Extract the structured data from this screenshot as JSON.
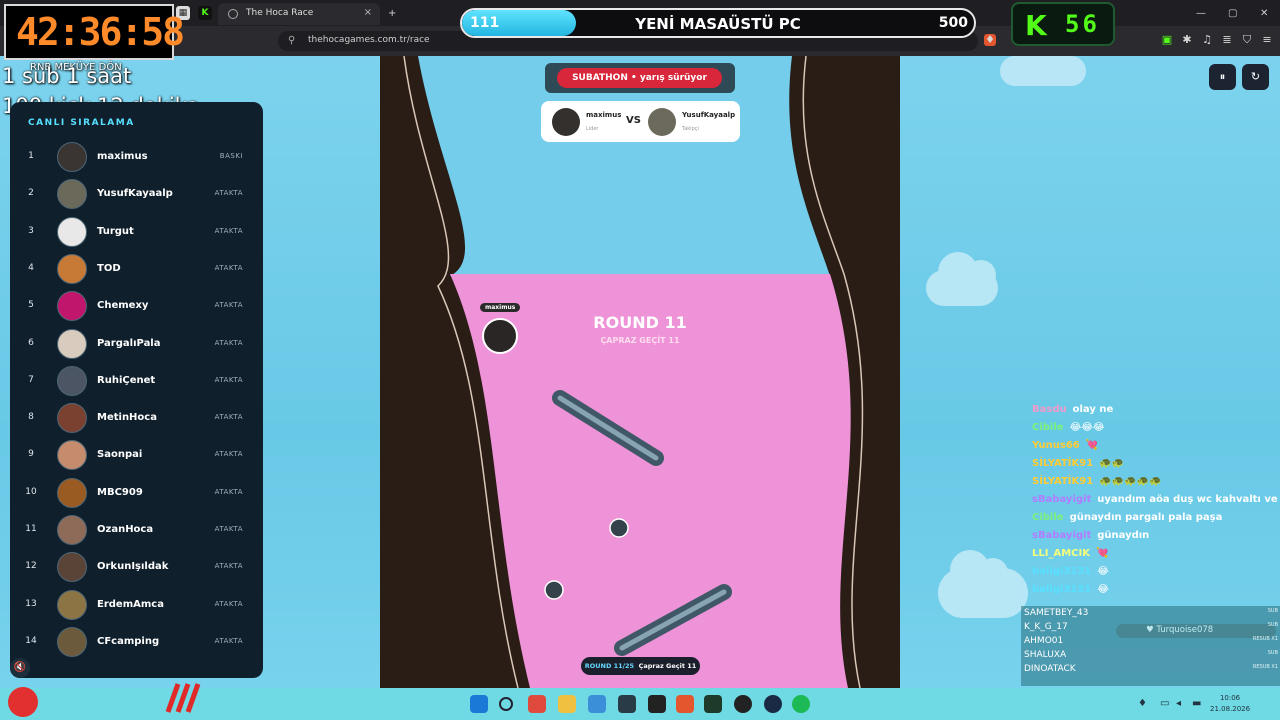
{
  "browser": {
    "tab_title": "The Hoca Race",
    "url": "thehocagames.com.tr/race"
  },
  "timer": "42:36:58",
  "progress": {
    "current": "111",
    "title": "YENİ MASAÜSTÜ PC",
    "max": "500",
    "fraction": 0.222
  },
  "kick_counter": {
    "letter": "K",
    "count": "56"
  },
  "overlay": {
    "line0": "RNB MEKÜYE DÖN",
    "line1": "1 sub 1 saat",
    "line2": "100 kick 12 dakika"
  },
  "leaderboard": {
    "header": "CANLI SIRALAMA",
    "rows": [
      {
        "rank": "1",
        "name": "maximus",
        "status": "BASKI",
        "color": "#3a3533"
      },
      {
        "rank": "2",
        "name": "YusufKayaalp",
        "status": "ATAKTA",
        "color": "#6b6a5a"
      },
      {
        "rank": "3",
        "name": "Turgut",
        "status": "ATAKTA",
        "color": "#e8e8e8"
      },
      {
        "rank": "4",
        "name": "TOD",
        "status": "ATAKTA",
        "color": "#c77a36"
      },
      {
        "rank": "5",
        "name": "Chemexy",
        "status": "ATAKTA",
        "color": "#c0166b"
      },
      {
        "rank": "6",
        "name": "PargalıPala",
        "status": "ATAKTA",
        "color": "#d9cbbd"
      },
      {
        "rank": "7",
        "name": "RuhiÇenet",
        "status": "ATAKTA",
        "color": "#4c5563"
      },
      {
        "rank": "8",
        "name": "MetinHoca",
        "status": "ATAKTA",
        "color": "#7a4030"
      },
      {
        "rank": "9",
        "name": "Saonpai",
        "status": "ATAKTA",
        "color": "#c48c6c"
      },
      {
        "rank": "10",
        "name": "MBC909",
        "status": "ATAKTA",
        "color": "#9a5b22"
      },
      {
        "rank": "11",
        "name": "OzanHoca",
        "status": "ATAKTA",
        "color": "#8e6a58"
      },
      {
        "rank": "12",
        "name": "OrkunIşıldak",
        "status": "ATAKTA",
        "color": "#5a4438"
      },
      {
        "rank": "13",
        "name": "ErdemAmca",
        "status": "ATAKTA",
        "color": "#8c7444"
      },
      {
        "rank": "14",
        "name": "CFcamping",
        "status": "ATAKTA",
        "color": "#6b5a3c"
      }
    ]
  },
  "game": {
    "subathon": "SUBATHON • yarış sürüyor",
    "vs": {
      "left_name": "maximus",
      "left_sub": "Lider",
      "vs": "VS",
      "right_name": "YusufKayaalp",
      "right_sub": "Takipçi"
    },
    "round_title": "ROUND 11",
    "round_subtitle": "ÇAPRAZ GEÇİT 11",
    "player_tag": "maximus",
    "round_pill_label": "ROUND 11/25",
    "round_pill_name": "Çapraz Geçit 11"
  },
  "controls": {
    "pause": "⏸",
    "refresh": "↻"
  },
  "chat": [
    {
      "user": "Basdu",
      "msg": "olay ne",
      "color": "#f39acb"
    },
    {
      "user": "Cibile",
      "msg": "😂😂😂",
      "color": "#7cf07c"
    },
    {
      "user": "Yunus66",
      "msg": "💘",
      "color": "#ffcc33"
    },
    {
      "user": "SİLYATİK91",
      "msg": "🐢🐢",
      "color": "#ffcc33"
    },
    {
      "user": "SİLYATİK91",
      "msg": "🐢🐢🐢🐢🐢",
      "color": "#ffcc33"
    },
    {
      "user": "sBabayigit",
      "msg": "uyandım aöa duş wc kahvaltı ve",
      "color": "#b37cff"
    },
    {
      "user": "Cibile",
      "msg": "günaydın pargalı pala paşa",
      "color": "#7cf07c"
    },
    {
      "user": "sBabayigit",
      "msg": "günaydın",
      "color": "#b37cff"
    },
    {
      "user": "LLI_AMCIK",
      "msg": "💘",
      "color": "#f6ff7a"
    },
    {
      "user": "baligi3131",
      "msg": "😂",
      "color": "#57e0ff"
    },
    {
      "user": "baligi3131",
      "msg": "😂",
      "color": "#57e0ff"
    }
  ],
  "recent_subs": [
    {
      "name": "SAMETBEY_43",
      "tag": "SUB"
    },
    {
      "name": "K_K_G_17",
      "tag": "SUB"
    },
    {
      "name": "AHMO01",
      "tag": "RESUB X1"
    },
    {
      "name": "SHALUXA",
      "tag": "SUB"
    },
    {
      "name": "DINOATACK",
      "tag": "RESUB X1"
    }
  ],
  "subs_highlight": "Turquoise078",
  "taskbar": {
    "time": "10:06",
    "date": "21.08.2026"
  }
}
